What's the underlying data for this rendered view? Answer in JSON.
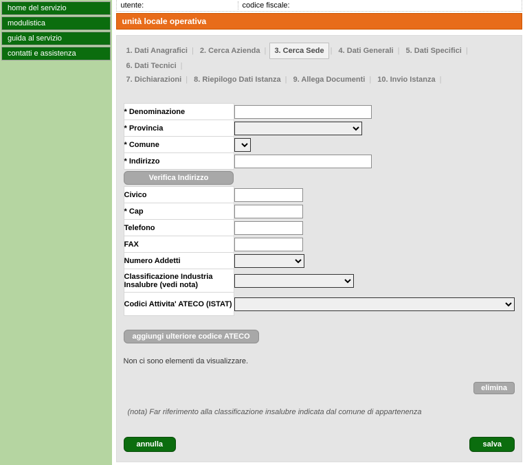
{
  "sidebar": {
    "items": [
      {
        "label": "home del servizio"
      },
      {
        "label": "modulistica"
      },
      {
        "label": "guida al servizio"
      },
      {
        "label": "contatti e assistenza"
      }
    ]
  },
  "topbar": {
    "utente_label": "utente:",
    "codice_label": "codice fiscale:"
  },
  "section": {
    "title": "unità locale operativa"
  },
  "wizard": {
    "steps": [
      "1. Dati Anagrafici",
      "2. Cerca Azienda",
      "3. Cerca Sede",
      "4. Dati Generali",
      "5. Dati Specifici",
      "6. Dati Tecnici",
      "7. Dichiarazioni",
      "8. Riepilogo Dati Istanza",
      "9. Allega Documenti",
      "10. Invio Istanza"
    ],
    "active_index": 2
  },
  "form": {
    "denominazione_label": "* Denominazione",
    "provincia_label": "* Provincia",
    "comune_label": "* Comune",
    "indirizzo_label": "* Indirizzo",
    "verifica_label": "Verifica Indirizzo",
    "civico_label": "Civico",
    "cap_label": "* Cap",
    "telefono_label": "Telefono",
    "fax_label": "FAX",
    "numero_addetti_label": "Numero Addetti",
    "class_industria_label": "Classificazione Industria Insalubre (vedi nota)",
    "codici_ateco_label": "Codici Attivita' ATECO (ISTAT)"
  },
  "buttons": {
    "add_ateco": "aggiungi ulteriore codice ATECO",
    "elimina": "elimina",
    "annulla": "annulla",
    "salva": "salva"
  },
  "messages": {
    "empty": "Non ci sono elementi da visualizzare.",
    "note": "(nota) Far riferimento alla classificazione insalubre indicata dal comune di appartenenza"
  }
}
